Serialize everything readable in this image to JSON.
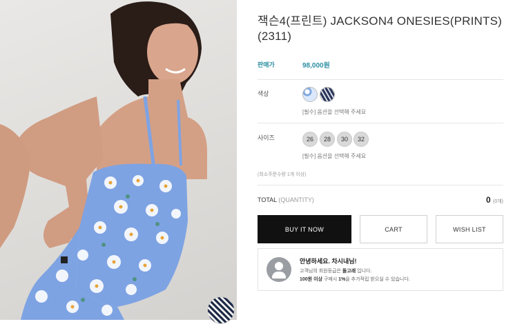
{
  "product": {
    "title": "잭슨4(프린트) JACKSON4 ONESIES(PRINTS)(2311)",
    "price_label": "판매가",
    "price": "98,000원"
  },
  "options": {
    "color_label": "색상",
    "color_swatches": [
      "floral-blue",
      "zebra-navy"
    ],
    "color_note": "[필수] 옵션을 선택해 주세요",
    "size_label": "사이즈",
    "sizes": [
      "26",
      "28",
      "30",
      "32"
    ],
    "size_note": "[필수] 옵션을 선택해 주세요",
    "min_order": "(최소주문수량 1개 이상)"
  },
  "total": {
    "label": "TOTAL",
    "quantity_label": "(QUANTITY)",
    "value": "0",
    "unit": "(0개)"
  },
  "buttons": {
    "buy": "BUY IT NOW",
    "cart": "CART",
    "wish": "WISH LIST"
  },
  "greeting": {
    "title": "안녕하세요. 차시내님!",
    "line1_prefix": "고객님의 회원등급은 ",
    "line1_grade": "돌고래",
    "line1_suffix": " 입니다.",
    "line2_amount": "100원 이상",
    "line2_mid": " 구매시 ",
    "line2_rate": "1%",
    "line2_suffix": "을 추가적립 받으실 수 있습니다."
  },
  "colors": {
    "accent": "#2e8fa3",
    "buy_button": "#111111"
  }
}
